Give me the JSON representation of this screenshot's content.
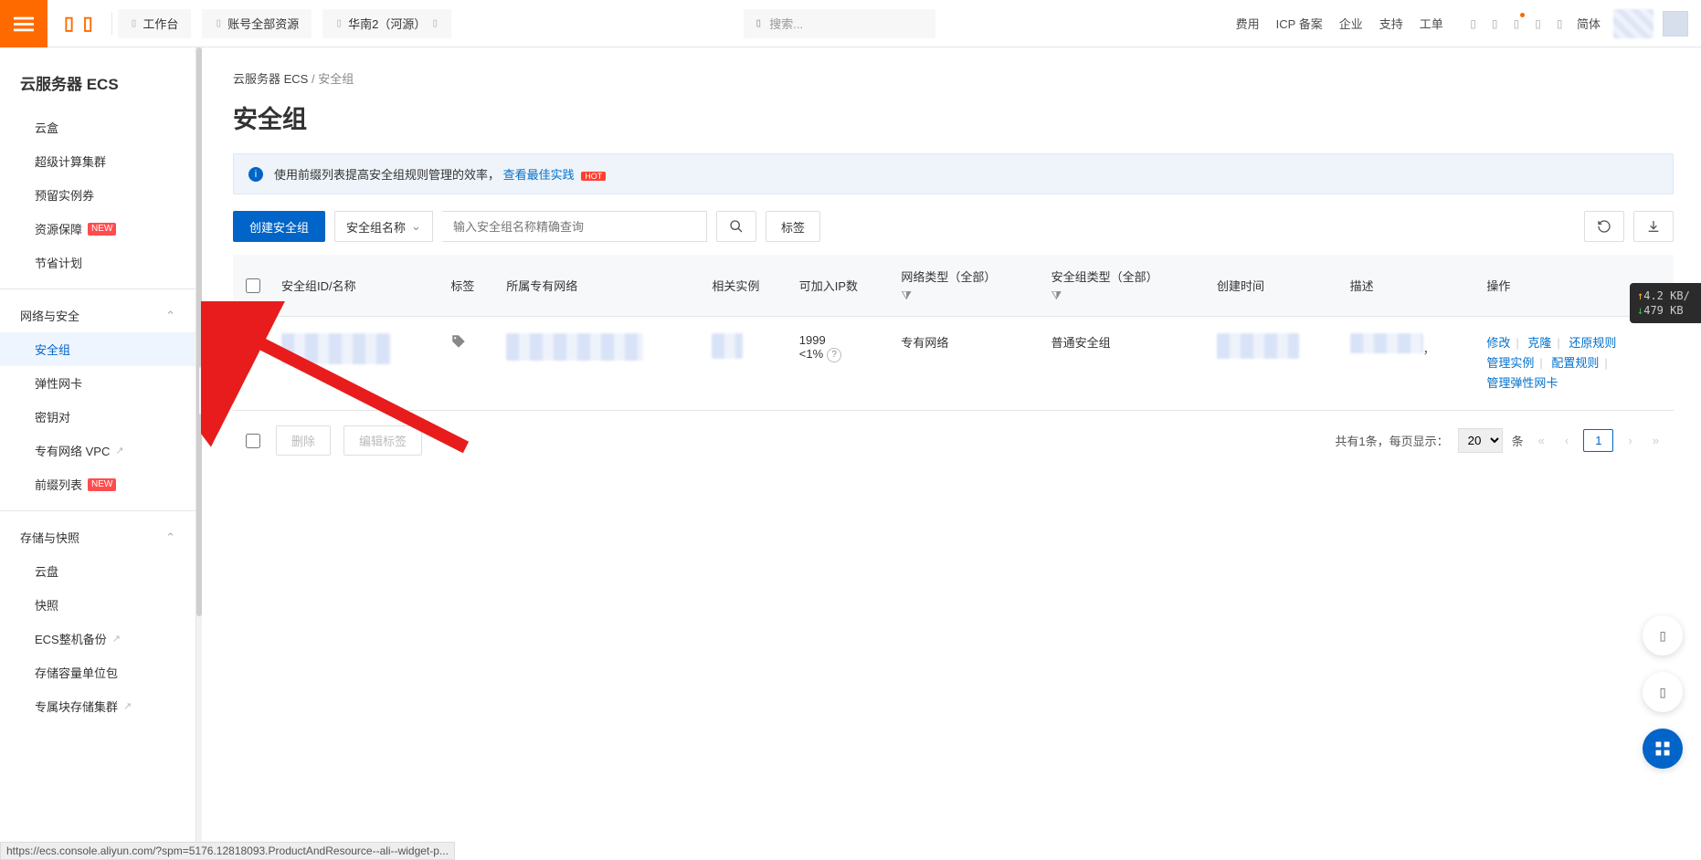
{
  "header": {
    "workbench": "工作台",
    "account_resources": "账号全部资源",
    "region": "华南2（河源）",
    "search_placeholder": "搜索...",
    "links": [
      "费用",
      "ICP 备案",
      "企业",
      "支持",
      "工单"
    ],
    "simplified": "简体"
  },
  "sidebar": {
    "title": "云服务器 ECS",
    "items_top": [
      {
        "label": "云盒"
      },
      {
        "label": "超级计算集群"
      },
      {
        "label": "预留实例券"
      },
      {
        "label": "资源保障",
        "new": true
      },
      {
        "label": "节省计划"
      }
    ],
    "group_net_label": "网络与安全",
    "net_items": [
      {
        "label": "安全组",
        "active": true
      },
      {
        "label": "弹性网卡"
      },
      {
        "label": "密钥对"
      },
      {
        "label": "专有网络 VPC",
        "ext": true
      },
      {
        "label": "前缀列表",
        "new": true
      }
    ],
    "group_storage_label": "存储与快照",
    "storage_items": [
      {
        "label": "云盘"
      },
      {
        "label": "快照"
      },
      {
        "label": "ECS整机备份",
        "ext": true
      },
      {
        "label": "存储容量单位包"
      },
      {
        "label": "专属块存储集群",
        "ext": true
      }
    ]
  },
  "breadcrumb": {
    "home": "云服务器 ECS",
    "current": "安全组"
  },
  "page_title": "安全组",
  "banner": {
    "text": "使用前缀列表提高安全组规则管理的效率，",
    "link": "查看最佳实践"
  },
  "toolbar": {
    "create": "创建安全组",
    "select": "安全组名称",
    "placeholder": "输入安全组名称精确查询",
    "tag": "标签"
  },
  "table": {
    "headers": {
      "id": "安全组ID/名称",
      "tags": "标签",
      "vpc": "所属专有网络",
      "instances": "相关实例",
      "ip": "可加入IP数",
      "nettype": "网络类型（全部）",
      "sgtype": "安全组类型（全部）",
      "created": "创建时间",
      "desc": "描述",
      "ops": "操作"
    },
    "row": {
      "ip_count": "1999",
      "ip_pct": "<1%",
      "nettype": "专有网络",
      "sgtype": "普通安全组"
    },
    "actions": [
      "修改",
      "克隆",
      "还原规则",
      "管理实例",
      "配置规则",
      "管理弹性网卡"
    ]
  },
  "footer": {
    "delete": "删除",
    "edit_tag": "编辑标签",
    "summary": "共有1条，每页显示：",
    "per_page": "20",
    "unit": "条",
    "page": "1"
  },
  "net_monitor": {
    "up": "4.2 KB/",
    "down": "479 KB"
  },
  "status_url": "https://ecs.console.aliyun.com/?spm=5176.12818093.ProductAndResource--ali--widget-p..."
}
